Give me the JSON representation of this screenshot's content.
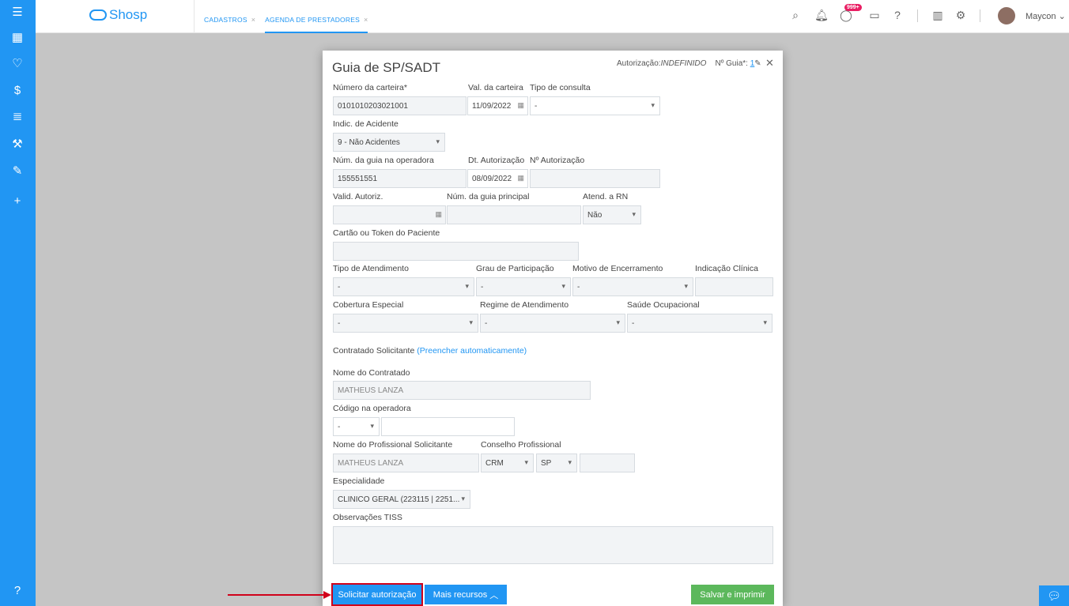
{
  "header": {
    "logo": "Shosp",
    "tabs": [
      {
        "label": "CADASTROS"
      },
      {
        "label": "AGENDA DE PRESTADORES"
      }
    ],
    "notification_badge": "999+",
    "user_name": "Maycon"
  },
  "modal": {
    "title": "Guia de SP/SADT",
    "auth_label": "Autorização:",
    "auth_value": "INDEFINIDO",
    "guia_label": "Nº Guia*:",
    "guia_number": "1",
    "fields": {
      "carteira_label": "Número da carteira*",
      "carteira_value": "0101010203021001",
      "val_carteira_label": "Val. da carteira",
      "val_carteira_value": "11/09/2022",
      "tipo_consulta_label": "Tipo de consulta",
      "tipo_consulta_value": "-",
      "indic_acidente_label": "Indic. de Acidente",
      "indic_acidente_value": "9 - Não Acidentes",
      "num_guia_op_label": "Núm. da guia na operadora",
      "num_guia_op_value": "155551551",
      "dt_autorizacao_label": "Dt. Autorização",
      "dt_autorizacao_value": "08/09/2022",
      "num_autorizacao_label": "Nº Autorização",
      "valid_autoriz_label": "Valid. Autoriz.",
      "num_guia_principal_label": "Núm. da guia principal",
      "atend_rn_label": "Atend. a RN",
      "atend_rn_value": "Não",
      "cartao_token_label": "Cartão ou Token do Paciente",
      "tipo_atendimento_label": "Tipo de Atendimento",
      "tipo_atendimento_value": "-",
      "grau_participacao_label": "Grau de Participação",
      "grau_participacao_value": "-",
      "motivo_encerramento_label": "Motivo de Encerramento",
      "motivo_encerramento_value": "-",
      "indicacao_clinica_label": "Indicação Clínica",
      "cobertura_especial_label": "Cobertura Especial",
      "cobertura_especial_value": "-",
      "regime_atendimento_label": "Regime de Atendimento",
      "regime_atendimento_value": "-",
      "saude_ocupacional_label": "Saúde Ocupacional",
      "saude_ocupacional_value": "-",
      "contratado_solicitante_label": "Contratado Solicitante",
      "preencher_link": "(Preencher automaticamente)",
      "nome_contratado_label": "Nome do Contratado",
      "nome_contratado_value": "MATHEUS LANZA",
      "codigo_operadora_label": "Código na operadora",
      "codigo_operadora_select": "-",
      "nome_profissional_label": "Nome do Profissional Solicitante",
      "nome_profissional_value": "MATHEUS LANZA",
      "conselho_label": "Conselho Profissional",
      "conselho_value": "CRM",
      "conselho_uf": "SP",
      "especialidade_label": "Especialidade",
      "especialidade_value": "CLINICO GERAL (223115 | 2251...",
      "observacoes_label": "Observações TISS"
    },
    "buttons": {
      "solicitar": "Solicitar autorização",
      "mais_recursos": "Mais recursos",
      "salvar": "Salvar e imprimir"
    }
  },
  "colors": {
    "primary": "#2196f3",
    "success": "#5cb85c",
    "highlight": "#d0021b"
  }
}
